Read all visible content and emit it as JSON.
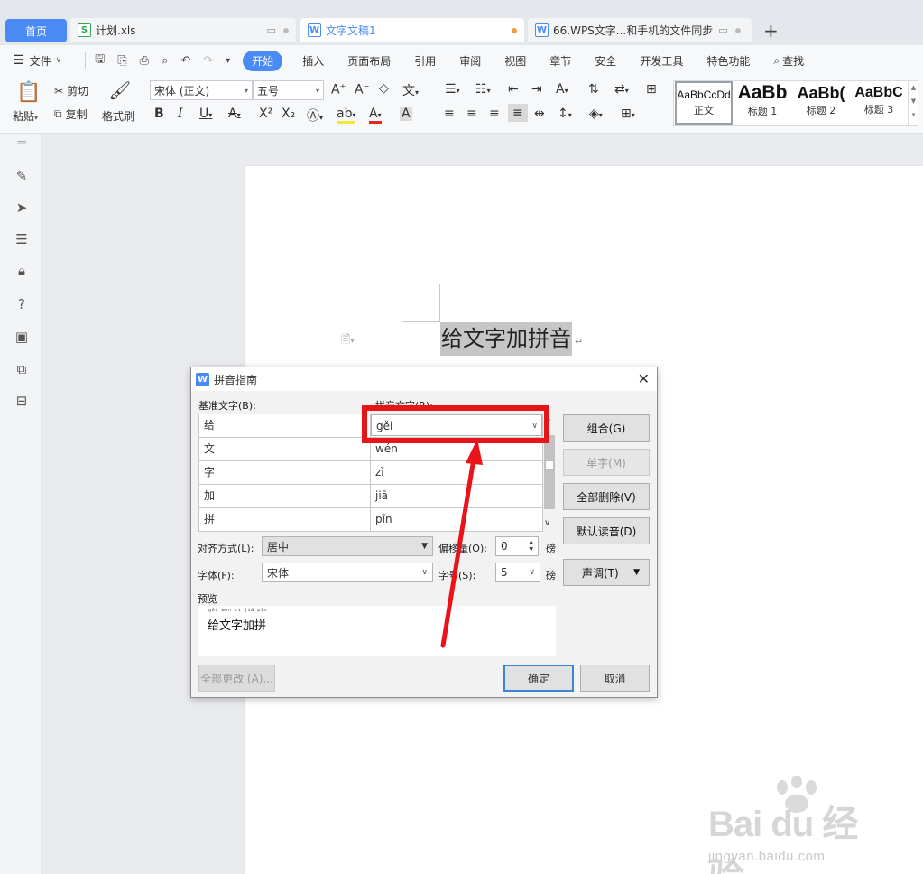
{
  "tabs": {
    "home": "首页",
    "xls": {
      "label": "计划.xls",
      "icon": "spreadsheet-icon"
    },
    "active_doc": {
      "label": "文字文稿1",
      "icon": "document-icon"
    },
    "doc2": {
      "label": "66.WPS文字...和手机的文件同步",
      "icon": "document-icon"
    },
    "add": "+"
  },
  "menu": {
    "file": "文件",
    "items": [
      "开始",
      "插入",
      "页面布局",
      "引用",
      "审阅",
      "视图",
      "章节",
      "安全",
      "开发工具",
      "特色功能"
    ],
    "search": "查找"
  },
  "toolbar": {
    "paste": "粘贴",
    "cut": "剪切",
    "copy": "复制",
    "format_painter": "格式刷",
    "font_name": "宋体 (正文)",
    "font_size": "五号",
    "styles": [
      {
        "preview": "AaBbCcDd",
        "name": "正文"
      },
      {
        "preview": "AaBb",
        "name": "标题 1"
      },
      {
        "preview": "AaBb(",
        "name": "标题 2"
      },
      {
        "preview": "AaBbC",
        "name": "标题 3"
      }
    ]
  },
  "document": {
    "text": "给文字加拼音",
    "para_mark": "↵"
  },
  "dialog": {
    "title": "拼音指南",
    "base_label": "基准文字(B):",
    "pinyin_label": "拼音文字(R):",
    "rows": [
      {
        "base": "给",
        "pinyin": "gěi"
      },
      {
        "base": "文",
        "pinyin": "wén"
      },
      {
        "base": "字",
        "pinyin": "zì"
      },
      {
        "base": "加",
        "pinyin": "jiā"
      },
      {
        "base": "拼",
        "pinyin": "pīn"
      }
    ],
    "buttons": {
      "group": "组合(G)",
      "single": "单字(M)",
      "delete_all": "全部删除(V)",
      "default_reading": "默认读音(D)",
      "tone": "声调(T)"
    },
    "align_label": "对齐方式(L):",
    "align_value": "居中",
    "offset_label": "偏移量(O):",
    "offset_value": "0",
    "offset_unit": "磅",
    "font_label": "字体(F):",
    "font_value": "宋体",
    "size_label": "字号(S):",
    "size_value": "5",
    "size_unit": "磅",
    "preview_label": "预览",
    "preview_pinyin": "gěi wén zì jiā pīn",
    "preview_text": "给文字加拼",
    "change_all": "全部更改 (A)...",
    "ok": "确定",
    "cancel": "取消"
  },
  "watermark": {
    "main": "Bai du 经验",
    "sub": "jingyan.baidu.com"
  },
  "colors": {
    "accent": "#4a8af4",
    "highlight_red": "#e8141a"
  }
}
